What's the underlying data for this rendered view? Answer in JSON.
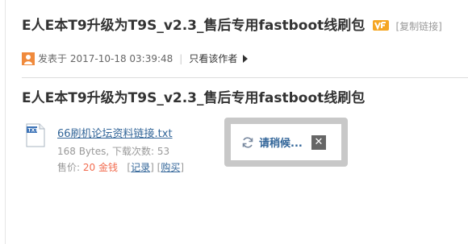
{
  "thread": {
    "title": "E人E本T9升级为T9S_v2.3_售后专用fastboot线刷包",
    "copy_link": "[复制链接]"
  },
  "meta": {
    "posted_prefix": "发表于",
    "posted_time": "2017-10-18 03:39:48",
    "separator": "|",
    "author_only": "只看该作者"
  },
  "post": {
    "title": "E人E本T9升级为T9S_v2.3_售后专用fastboot线刷包",
    "attachment": {
      "filename": "66刷机论坛资料链接.txt",
      "size_downloads": "168 Bytes, 下载次数: 53",
      "price_label": "售价:",
      "price_value": "20 金钱",
      "record_label": "记录",
      "buy_label": "购买",
      "bracket_open": "[",
      "bracket_close": "]"
    }
  },
  "loading_dialog": {
    "text": "请稍候...",
    "close_glyph": "✕"
  },
  "colors": {
    "link": "#336699",
    "price": "#f26c4f",
    "badge": "#f5a623"
  },
  "icons": {
    "badge": "vip-badge-icon",
    "user": "user-icon",
    "file": "txt-file-icon",
    "refresh": "refresh-icon",
    "close": "close-icon"
  }
}
